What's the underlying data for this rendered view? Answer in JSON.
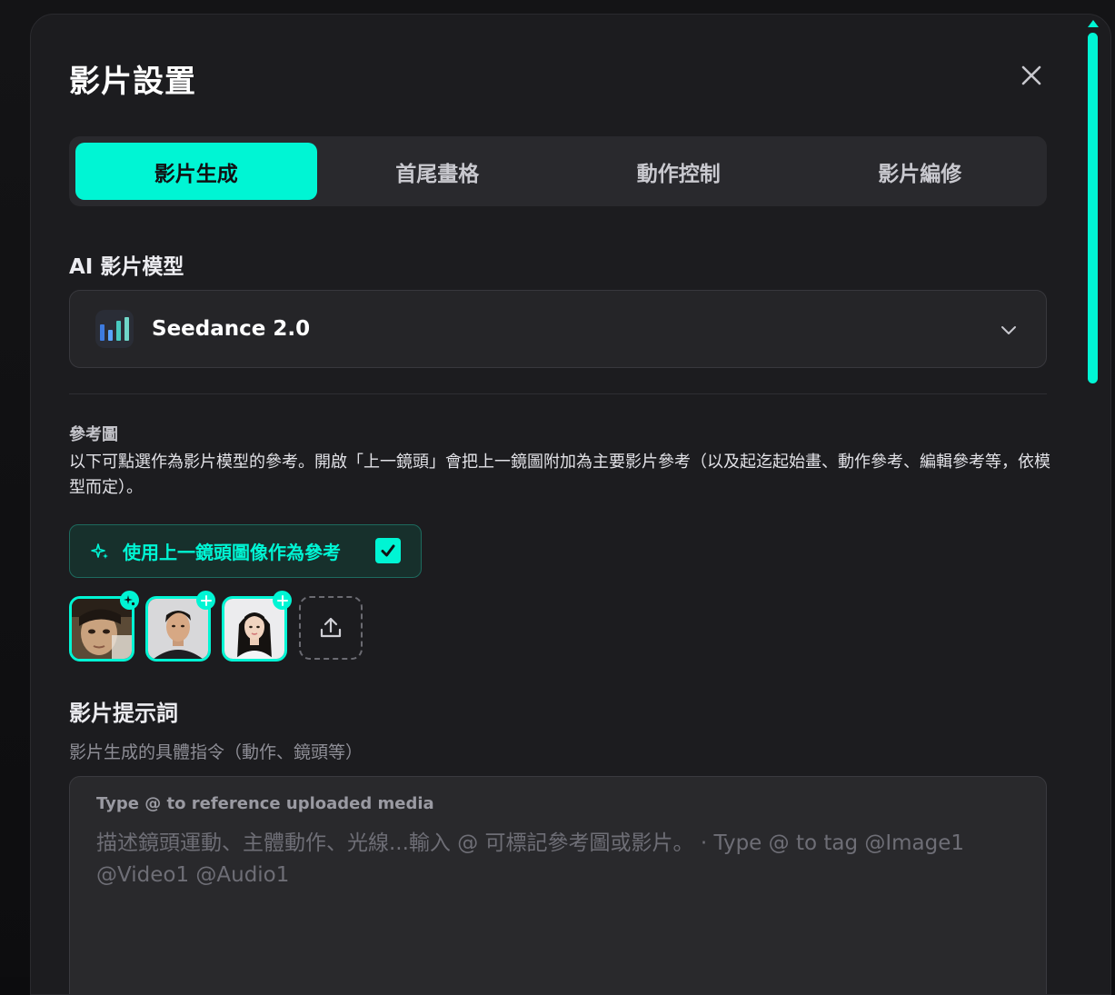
{
  "dialog": {
    "title": "影片設置",
    "close_label": "×"
  },
  "tabs": [
    {
      "label": "影片生成",
      "active": true
    },
    {
      "label": "首尾畫格",
      "active": false
    },
    {
      "label": "動作控制",
      "active": false
    },
    {
      "label": "影片編修",
      "active": false
    }
  ],
  "model": {
    "section_label": "AI 影片模型",
    "selected": "Seedance 2.0",
    "icon": "seedance-logo-icon"
  },
  "reference": {
    "title": "參考圖",
    "description": "以下可點選作為影片模型的參考。開啟「上一鏡頭」會把上一鏡圖附加為主要影片參考（以及起迄起始畫、動作參考、編輯參考等，依模型而定）。",
    "use_previous_label": "使用上一鏡頭圖像作為參考",
    "use_previous_checked": true,
    "thumbnails": [
      {
        "name": "previous-shot-thumbnail",
        "badge": "sparkle-icon"
      },
      {
        "name": "man-portrait-thumbnail",
        "badge": "plus-icon"
      },
      {
        "name": "woman-portrait-thumbnail",
        "badge": "plus-icon"
      }
    ],
    "upload_icon": "upload-icon"
  },
  "prompt": {
    "title": "影片提示詞",
    "subtitle": "影片生成的具體指令（動作、鏡頭等）",
    "hint": "Type @ to reference uploaded media",
    "placeholder": "描述鏡頭運動、主體動作、光線...輸入 @ 可標記參考圖或影片。 · Type @ to tag @Image1 @Video1 @Audio1",
    "value": ""
  },
  "colors": {
    "accent": "#00f5d4",
    "panel": "#1c1c1f",
    "field": "#252528"
  }
}
